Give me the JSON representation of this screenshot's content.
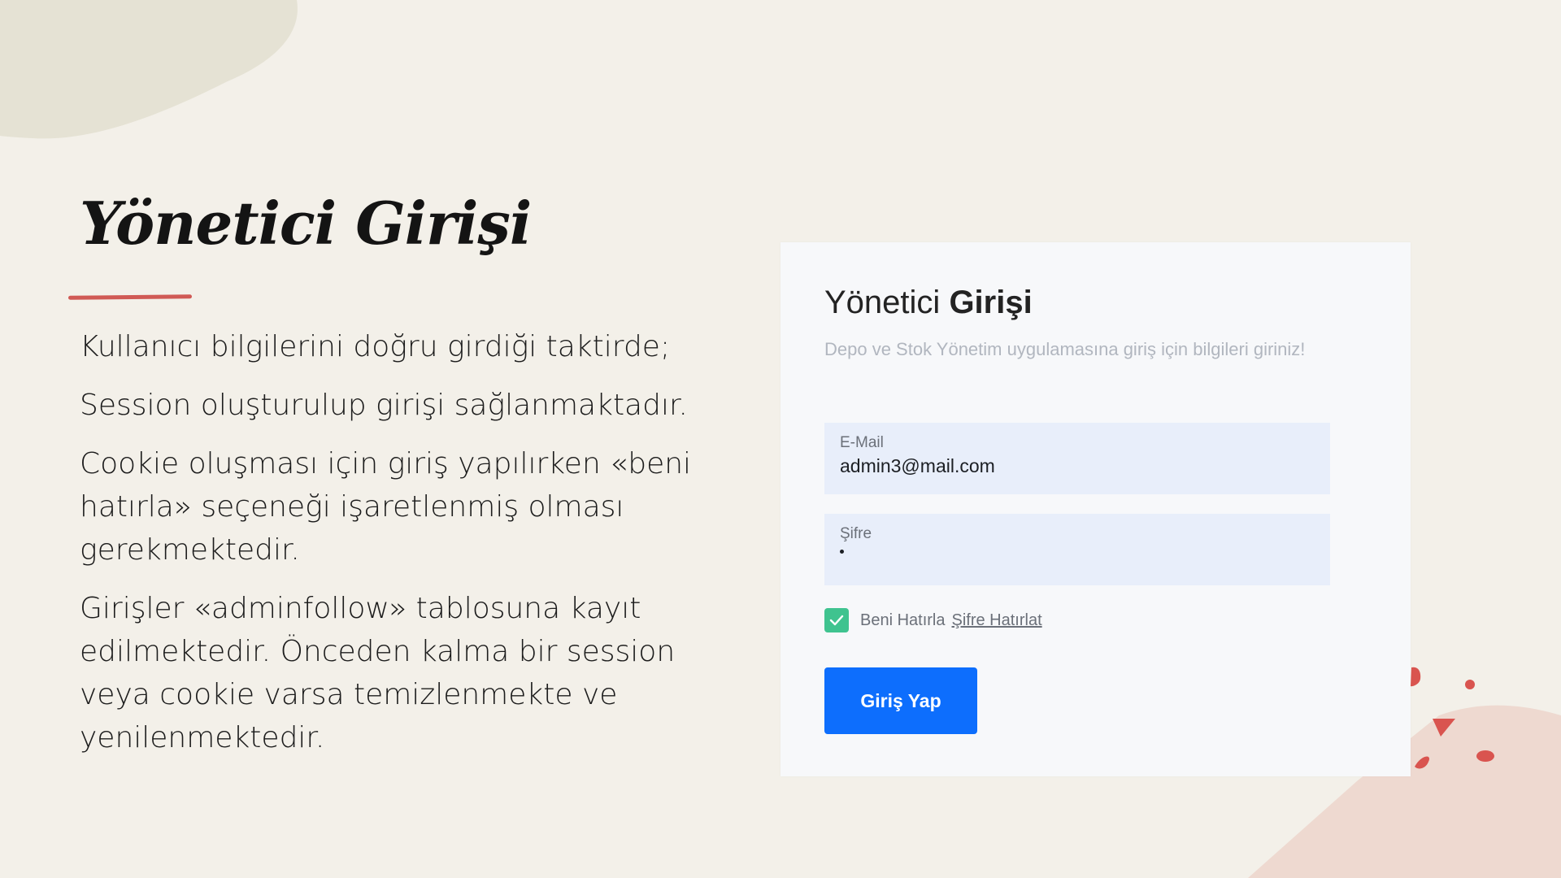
{
  "slide": {
    "title": "Yönetici Girişi",
    "paragraphs": [
      "Kullanıcı bilgilerini doğru girdiği taktirde;",
      "Session oluşturulup girişi sağlanmaktadır.",
      "Cookie oluşması için giriş yapılırken «beni hatırla» seçeneği işaretlenmiş olması gerekmektedir.",
      "Girişler «adminfollow» tablosuna kayıt edilmektedir. Önceden kalma bir session veya cookie varsa temizlenmekte ve yenilenmektedir."
    ]
  },
  "login_card": {
    "title_light": "Yönetici",
    "title_bold": "Girişi",
    "subtitle": "Depo ve Stok Yönetim uygulamasına giriş için bilgileri giriniz!",
    "email": {
      "label": "E-Mail",
      "value": "admin3@mail.com"
    },
    "password": {
      "label": "Şifre",
      "masked_length": 1
    },
    "remember": {
      "label": "Beni Hatırla",
      "checked": true
    },
    "forgot_link": "Şifre Hatırlat",
    "submit_label": "Giriş Yap"
  },
  "colors": {
    "background": "#f3f0e9",
    "accent_underline": "#d05a55",
    "card_background": "#f7f8fa",
    "input_background": "#e8eefa",
    "checkbox": "#3fc38f",
    "button": "#0d6efd",
    "decor_dots": "#d9544f"
  }
}
